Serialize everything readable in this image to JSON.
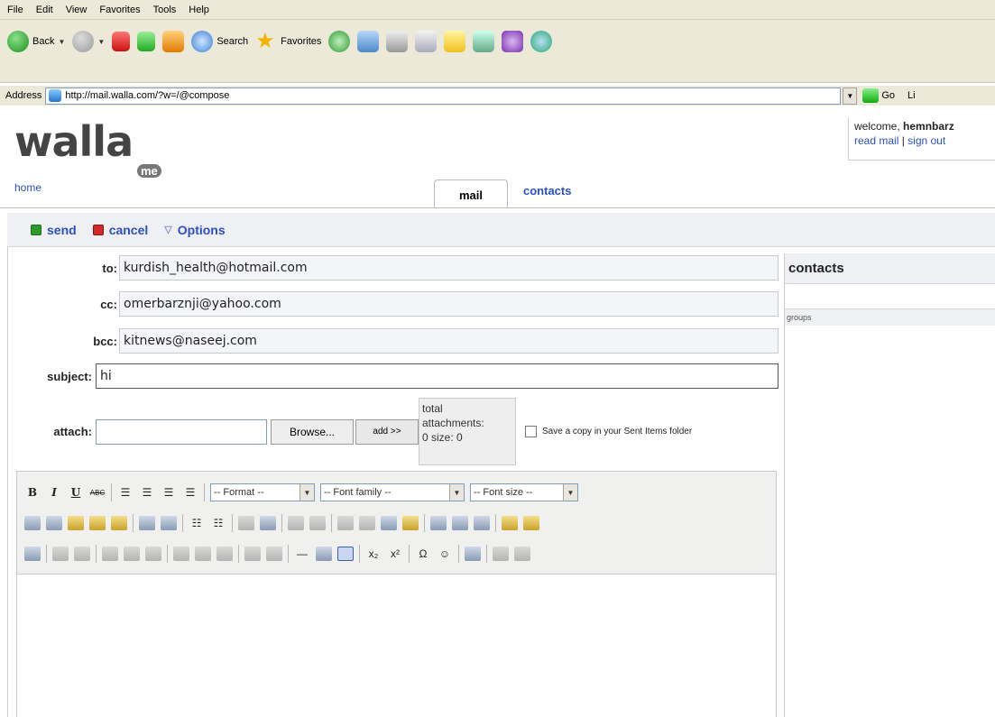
{
  "browser": {
    "menu": [
      "File",
      "Edit",
      "View",
      "Favorites",
      "Tools",
      "Help"
    ],
    "toolbar": {
      "back": "Back",
      "search": "Search",
      "favorites": "Favorites"
    },
    "address_label": "Address",
    "url": "http://mail.walla.com/?w=/@compose",
    "go": "Go",
    "links": "Li"
  },
  "site": {
    "logo": "walla",
    "logo_sub": "me",
    "home": "home",
    "welcome_prefix": "welcome, ",
    "username": "hemnbarz",
    "read_mail": "read mail",
    "separator": " | ",
    "sign_out": "sign out",
    "tabs": {
      "mail": "mail",
      "contacts": "contacts"
    }
  },
  "actions": {
    "send": "send",
    "cancel": "cancel",
    "options": "Options"
  },
  "compose": {
    "to_label": "to:",
    "to": "kurdish_health@hotmail.com",
    "cc_label": "cc:",
    "cc": "omerbarznji@yahoo.com",
    "bcc_label": "bcc:",
    "bcc": "kitnews@naseej.com",
    "subject_label": "subject:",
    "subject": "hi",
    "attach_label": "attach:",
    "browse": "Browse...",
    "add": "add >>",
    "total_line1": "total",
    "total_line2": "attachments:",
    "total_line3": "0 size: 0",
    "save_copy": "Save a copy in your Sent Items folder"
  },
  "editor": {
    "format": "-- Format --",
    "font_family": "-- Font family --",
    "font_size": "-- Font size --"
  },
  "contacts_panel": {
    "title": "contacts",
    "groups": "groups"
  },
  "colors": {
    "link": "#2c4fc7",
    "chrome": "#ece9d8",
    "send": "#2d9a2d",
    "cancel": "#d12a2a"
  }
}
